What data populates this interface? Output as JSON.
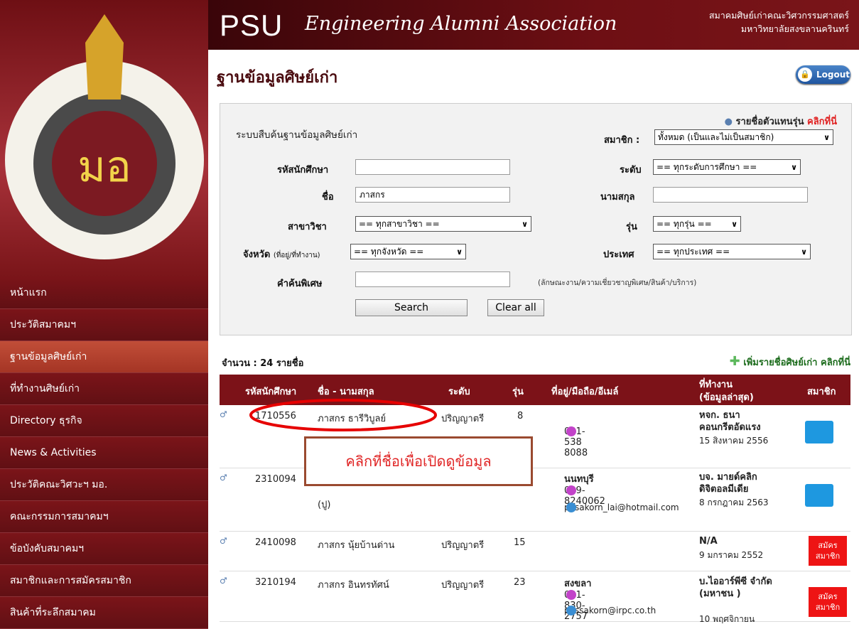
{
  "header": {
    "brand": "PSU",
    "assoc": "Engineering Alumni Association",
    "thai_line1": "สมาคมศิษย์เก่าคณะวิศวกรรมศาสตร์",
    "thai_line2": "มหาวิทยาลัยสงขลานครินทร์"
  },
  "sidebar": {
    "items": [
      {
        "label": "หน้าแรก"
      },
      {
        "label": "ประวัติสมาคมฯ"
      },
      {
        "label": "ฐานข้อมูลศิษย์เก่า"
      },
      {
        "label": "ที่ทำงานศิษย์เก่า"
      },
      {
        "label": "Directory ธุรกิจ"
      },
      {
        "label": "News & Activities"
      },
      {
        "label": "ประวัติคณะวิศวะฯ มอ."
      },
      {
        "label": "คณะกรรมการสมาคมฯ"
      },
      {
        "label": "ข้อบังคับสมาคมฯ"
      },
      {
        "label": "สมาชิกและการสมัครสมาชิก"
      },
      {
        "label": "สินค้าที่ระลึกสมาคม"
      }
    ]
  },
  "page": {
    "title": "ฐานข้อมูลศิษย์เก่า",
    "logout": "Logout"
  },
  "search": {
    "heading": "ระบบสืบค้นฐานข้อมูลศิษย์เก่า",
    "rep_label": "รายชื่อตัวแทนรุ่น",
    "rep_link": "คลิกที่นี่",
    "member_label": "สมาชิก :",
    "member_value": "ทั้งหมด (เป็นและไม่เป็นสมาชิก)",
    "student_id_label": "รหัสนักศึกษา",
    "student_id_value": "",
    "level_label": "ระดับ",
    "level_value": "== ทุกระดับการศึกษา ==",
    "name_label": "ชื่อ",
    "name_value": "ภาสกร",
    "surname_label": "นามสกุล",
    "surname_value": "",
    "major_label": "สาขาวิชา",
    "major_value": "== ทุกสาขาวิชา ==",
    "batch_label": "รุ่น",
    "batch_value": "== ทุกรุ่น ==",
    "province_label": "จังหวัด",
    "province_sub": "(ที่อยู่/ที่ทำงาน)",
    "province_value": "== ทุกจังหวัด ==",
    "country_label": "ประเทศ",
    "country_value": "== ทุกประเทศ ==",
    "keyword_label": "คำค้นพิเศษ",
    "keyword_value": "",
    "keyword_hint": "(ลักษณะงาน/ความเชี่ยวชาญพิเศษ/สินค้า/บริการ)",
    "search_button": "Search",
    "clear_button": "Clear all"
  },
  "results": {
    "count": "จำนวน : 24 รายชื่อ",
    "add_text": "เพิ่มรายชื่อศิษย์เก่า",
    "add_link": "คลิกที่นี่",
    "columns": {
      "student_id": "รหัสนักศึกษา",
      "name": "ชื่อ - นามสกุล",
      "level": "ระดับ",
      "batch": "รุ่น",
      "address": "ที่อยู่/มือถือ/อีเมล์",
      "work_line1": "ที่ทำงาน",
      "work_line2": "(ข้อมูลล่าสุด)",
      "member": "สมาชิก"
    },
    "rows": [
      {
        "id": "1710556",
        "name": "ภาสกร ธารีวิบูลย์",
        "level": "ปริญญาตรี",
        "batch": "8",
        "addr_city": "",
        "phone": "081-538 8088",
        "email": "",
        "work": "หจก. ธนา คอนกรีตอัดแรง",
        "work_date": "15 สิงหาคม 2556"
      },
      {
        "id": "2310094",
        "name": "(ปู)",
        "level": "",
        "batch": "",
        "addr_city": "นนทบุรี",
        "phone": "089-8240062",
        "email": "pasakorn_lai@hotmail.com",
        "work": "บจ. มายด์คลิก ดิจิตอลมีเดีย",
        "work_date": "8 กรกฎาคม 2563"
      },
      {
        "id": "2410098",
        "name": "ภาสกร นุ้ยบ้านด่าน",
        "level": "ปริญญาตรี",
        "batch": "15",
        "addr_city": "",
        "phone": "",
        "email": "",
        "work": "N/A",
        "work_date": "9 มกราคม 2552",
        "apply": "สมัคร สมาชิก"
      },
      {
        "id": "3210194",
        "name": "ภาสกร อินทรทัศน์",
        "level": "ปริญญาตรี",
        "batch": "23",
        "addr_city": "สงขลา",
        "phone": "081-830-2757",
        "email": "passakorn@irpc.co.th",
        "work": "บ.ไออาร์พีซี จำกัด (มหาชน )",
        "work_date": "10 พฤศจิกายน",
        "apply": "สมัคร สมาชิก"
      }
    ]
  },
  "annotation": {
    "callout": "คลิกที่ชื่อเพื่อเปิดดูข้อมูล"
  },
  "colors": {
    "sidebar": "#6e0f14",
    "active_nav": "#b54330",
    "table_header": "#7c1218",
    "annotation": "#e02626"
  }
}
